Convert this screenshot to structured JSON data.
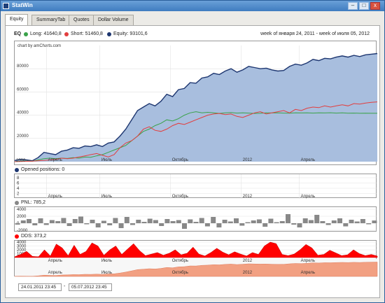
{
  "window": {
    "title": "StatWin",
    "buttons": [
      "–",
      "□",
      "x"
    ]
  },
  "tabs": [
    "Equity",
    "SummaryTab",
    "Quotes",
    "Dollar Volume"
  ],
  "legend": {
    "name": "EQ",
    "long": "Long: 41640,8",
    "short": "Short: 51460,8",
    "equity": "Equity: 93101,6",
    "period": "week of января 24, 2011 - week of июля 05, 2012"
  },
  "colors": {
    "long": "#3aa24a",
    "short": "#e23e3e",
    "equity": "#1d3670",
    "equity_fill": "#a8bede",
    "pnl": "#888888",
    "dds": "#ff0000",
    "scroll": "#f2a082"
  },
  "watermark": "chart by amCharts.com",
  "x_labels": [
    "Апрель",
    "Июль",
    "Октябрь",
    "2012",
    "Апрель"
  ],
  "x_labels_main": [
    "2000",
    "Апрель",
    "Июль",
    "Октябрь",
    "2012",
    "Апрель"
  ],
  "opened": {
    "label": "Opened positions: 0",
    "ticks": [
      "8",
      "6",
      "4",
      "2"
    ]
  },
  "pnl": {
    "label": "PNL: 785,2",
    "ticks": [
      "4000",
      "2000",
      "0",
      "-2000"
    ]
  },
  "dds": {
    "label": "DDS: 373,2",
    "ticks": [
      "4000",
      "3000",
      "2000",
      "1000"
    ]
  },
  "range": {
    "from": "24.01.2011 23:45",
    "to": "05.07.2012 23:45",
    "separator": "-"
  },
  "chart_data": [
    {
      "type": "area",
      "title": "EQ",
      "ylim": [
        0,
        100000
      ],
      "yticks": [
        20000,
        40000,
        60000,
        80000
      ],
      "series": [
        {
          "name": "Equity",
          "values": [
            1000,
            2000,
            1500,
            800,
            3500,
            8000,
            7000,
            6000,
            9000,
            10000,
            12000,
            11500,
            13500,
            13000,
            14500,
            13000,
            16000,
            17000,
            22000,
            28000,
            36000,
            44000,
            47000,
            50000,
            48000,
            52000,
            58000,
            56000,
            62000,
            63000,
            68000,
            67500,
            72000,
            73000,
            76000,
            75000,
            78000,
            80000,
            77000,
            79000,
            82000,
            81000,
            80000,
            80500,
            79000,
            78000,
            78500,
            82000,
            84000,
            83000,
            85000,
            88000,
            87000,
            89000,
            88500,
            90000,
            91000,
            90000,
            91500,
            90500,
            92000,
            92500,
            93101.6
          ]
        },
        {
          "name": "Long",
          "values": [
            0,
            500,
            600,
            300,
            1500,
            2500,
            3000,
            2500,
            3000,
            2800,
            3500,
            3000,
            4000,
            3800,
            5000,
            6000,
            8000,
            10000,
            12000,
            14000,
            18000,
            22000,
            26000,
            28000,
            31000,
            33000,
            36000,
            35000,
            37000,
            40000,
            42000,
            43000,
            42000,
            42500,
            42000,
            41500,
            42000,
            42200,
            41800,
            42000,
            41800,
            41500,
            41600,
            42000,
            41900,
            42000,
            41800,
            41700,
            42000,
            41900,
            42000,
            41800,
            42000,
            41900,
            42100,
            41800,
            42000,
            41700,
            41800,
            41600,
            41700,
            41600,
            41640.8
          ]
        },
        {
          "name": "Short",
          "values": [
            0,
            200,
            300,
            500,
            800,
            1000,
            1500,
            2000,
            3000,
            2500,
            3000,
            4000,
            5000,
            6000,
            7000,
            5500,
            4000,
            6000,
            12000,
            16000,
            18000,
            22000,
            28000,
            30000,
            27000,
            26000,
            28000,
            31000,
            33000,
            32000,
            34000,
            36000,
            38000,
            40000,
            41000,
            41500,
            40500,
            41000,
            39000,
            38000,
            40000,
            42000,
            43000,
            41000,
            42000,
            43000,
            44000,
            42000,
            45000,
            44000,
            46000,
            47000,
            46500,
            48000,
            47000,
            48000,
            49000,
            48000,
            50000,
            49500,
            50500,
            51000,
            51460.8
          ]
        }
      ]
    },
    {
      "type": "bar",
      "title": "PNL",
      "ylim": [
        -2000,
        4000
      ],
      "values": [
        -400,
        800,
        1200,
        -600,
        1400,
        -500,
        900,
        600,
        1500,
        -800,
        1200,
        1900,
        -300,
        1000,
        -1200,
        700,
        -600,
        1500,
        -1400,
        1800,
        -500,
        1000,
        400,
        1300,
        900,
        -800,
        1200,
        600,
        900,
        -1600,
        1100,
        400,
        1500,
        -900,
        1800,
        -1200,
        1000,
        500,
        1400,
        -700,
        300,
        800,
        1100,
        -1000,
        1300,
        300,
        600,
        2600,
        -400,
        -1200,
        1400,
        900,
        2400,
        600,
        -500,
        800,
        1400,
        -900,
        1000,
        500,
        1200,
        -300,
        785.2
      ]
    },
    {
      "type": "area",
      "title": "DDS",
      "ylim": [
        0,
        4000
      ],
      "values": [
        200,
        800,
        1600,
        300,
        200,
        2000,
        400,
        3500,
        2500,
        500,
        3200,
        800,
        1600,
        3800,
        3000,
        600,
        2000,
        3000,
        800,
        2200,
        3600,
        1800,
        500,
        900,
        1300,
        600,
        1100,
        2000,
        700,
        1100,
        2700,
        900,
        400,
        1300,
        2400,
        1400,
        700,
        1500,
        900,
        400,
        1300,
        800,
        3000,
        4000,
        3600,
        800,
        500,
        900,
        2000,
        3400,
        2500,
        600,
        800,
        1900,
        1200,
        500,
        700,
        2000,
        1000,
        500,
        800,
        373.2
      ]
    }
  ]
}
